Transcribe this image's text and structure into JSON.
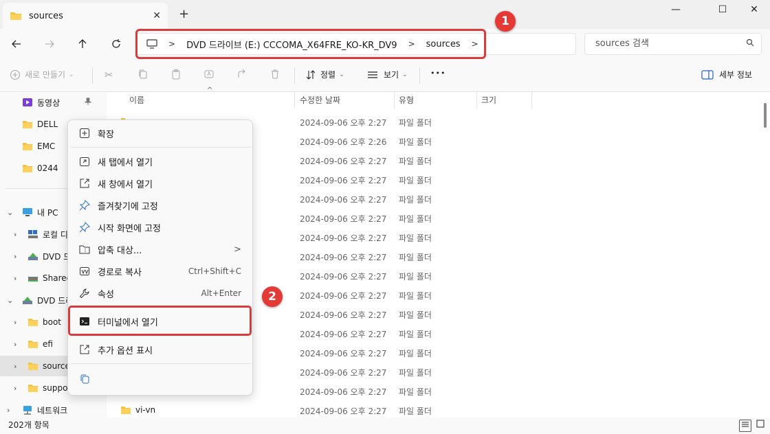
{
  "window": {
    "tab_title": "sources",
    "tab_close": "✕",
    "new_tab": "+",
    "minimize": "—",
    "maximize": "☐",
    "close": "✕"
  },
  "address": {
    "breadcrumbs": [
      "DVD 드라이브 (E:) CCCOMA_X64FRE_KO-KR_DV9",
      "sources"
    ],
    "separator": ">",
    "search_placeholder": "sources 검색"
  },
  "annotations": {
    "badge1": "1",
    "badge2": "2"
  },
  "toolbar": {
    "new_label": "새로 만들기",
    "sort_label": "정렬",
    "view_label": "보기",
    "more_label": "•••",
    "details_label": "세부 정보"
  },
  "sidebar": {
    "items": [
      {
        "label": "동영상",
        "pinned": true
      },
      {
        "label": "DELL"
      },
      {
        "label": "EMC"
      },
      {
        "label": "0244"
      },
      {
        "label": "내 PC"
      },
      {
        "label": "로컬 디스크"
      },
      {
        "label": "DVD 드라이브"
      },
      {
        "label": "Shared"
      },
      {
        "label": "DVD 드라이브"
      },
      {
        "label": "boot"
      },
      {
        "label": "efi"
      },
      {
        "label": "sources"
      },
      {
        "label": "support"
      },
      {
        "label": "네트워크"
      }
    ]
  },
  "list": {
    "columns": [
      "이름",
      "수정한 날짜",
      "유형",
      "크기"
    ],
    "rows": [
      {
        "name": "",
        "date": "2024-09-06 오후 2:27",
        "type": "파일 폴더"
      },
      {
        "name": "",
        "date": "2024-09-06 오후 2:26",
        "type": "파일 폴더"
      },
      {
        "name": "",
        "date": "2024-09-06 오후 2:27",
        "type": "파일 폴더"
      },
      {
        "name": "",
        "date": "2024-09-06 오후 2:27",
        "type": "파일 폴더"
      },
      {
        "name": "",
        "date": "2024-09-06 오후 2:27",
        "type": "파일 폴더"
      },
      {
        "name": "",
        "date": "2024-09-06 오후 2:27",
        "type": "파일 폴더"
      },
      {
        "name": "",
        "date": "2024-09-06 오후 2:27",
        "type": "파일 폴더"
      },
      {
        "name": "",
        "date": "2024-09-06 오후 2:27",
        "type": "파일 폴더"
      },
      {
        "name": "",
        "date": "2024-09-06 오후 2:27",
        "type": "파일 폴더"
      },
      {
        "name": "",
        "date": "2024-09-06 오후 2:27",
        "type": "파일 폴더"
      },
      {
        "name": "",
        "date": "2024-09-06 오후 2:27",
        "type": "파일 폴더"
      },
      {
        "name": "",
        "date": "2024-09-06 오후 2:27",
        "type": "파일 폴더"
      },
      {
        "name": "",
        "date": "2024-09-06 오후 2:27",
        "type": "파일 폴더"
      },
      {
        "name": "",
        "date": "2024-09-06 오후 2:27",
        "type": "파일 폴더"
      },
      {
        "name": "",
        "date": "2024-09-06 오후 2:27",
        "type": "파일 폴더"
      },
      {
        "name": "vi-vn",
        "date": "2024-09-06 오후 2:27",
        "type": "파일 폴더"
      }
    ]
  },
  "status": {
    "item_count": "202개 항목"
  },
  "context_menu": {
    "items": [
      {
        "label": "확장",
        "icon": "plus-box-icon"
      },
      {
        "label": "새 탭에서 열기",
        "icon": "new-tab-icon"
      },
      {
        "label": "새 창에서 열기",
        "icon": "new-window-icon"
      },
      {
        "label": "즐겨찾기에 고정",
        "icon": "pin-icon"
      },
      {
        "label": "시작 화면에 고정",
        "icon": "pin-icon"
      },
      {
        "label": "압축 대상...",
        "icon": "zip-icon",
        "arrow": ">"
      },
      {
        "label": "경로로 복사",
        "icon": "copy-path-icon",
        "shortcut": "Ctrl+Shift+C"
      },
      {
        "label": "속성",
        "icon": "wrench-icon",
        "shortcut": "Alt+Enter"
      },
      {
        "label": "터미널에서 열기",
        "icon": "terminal-icon"
      },
      {
        "label": "추가 옵션 표시",
        "icon": "more-options-icon"
      }
    ]
  },
  "colors": {
    "folder": "#f6c344",
    "highlight": "#d93b3b",
    "badge": "#e53935"
  }
}
